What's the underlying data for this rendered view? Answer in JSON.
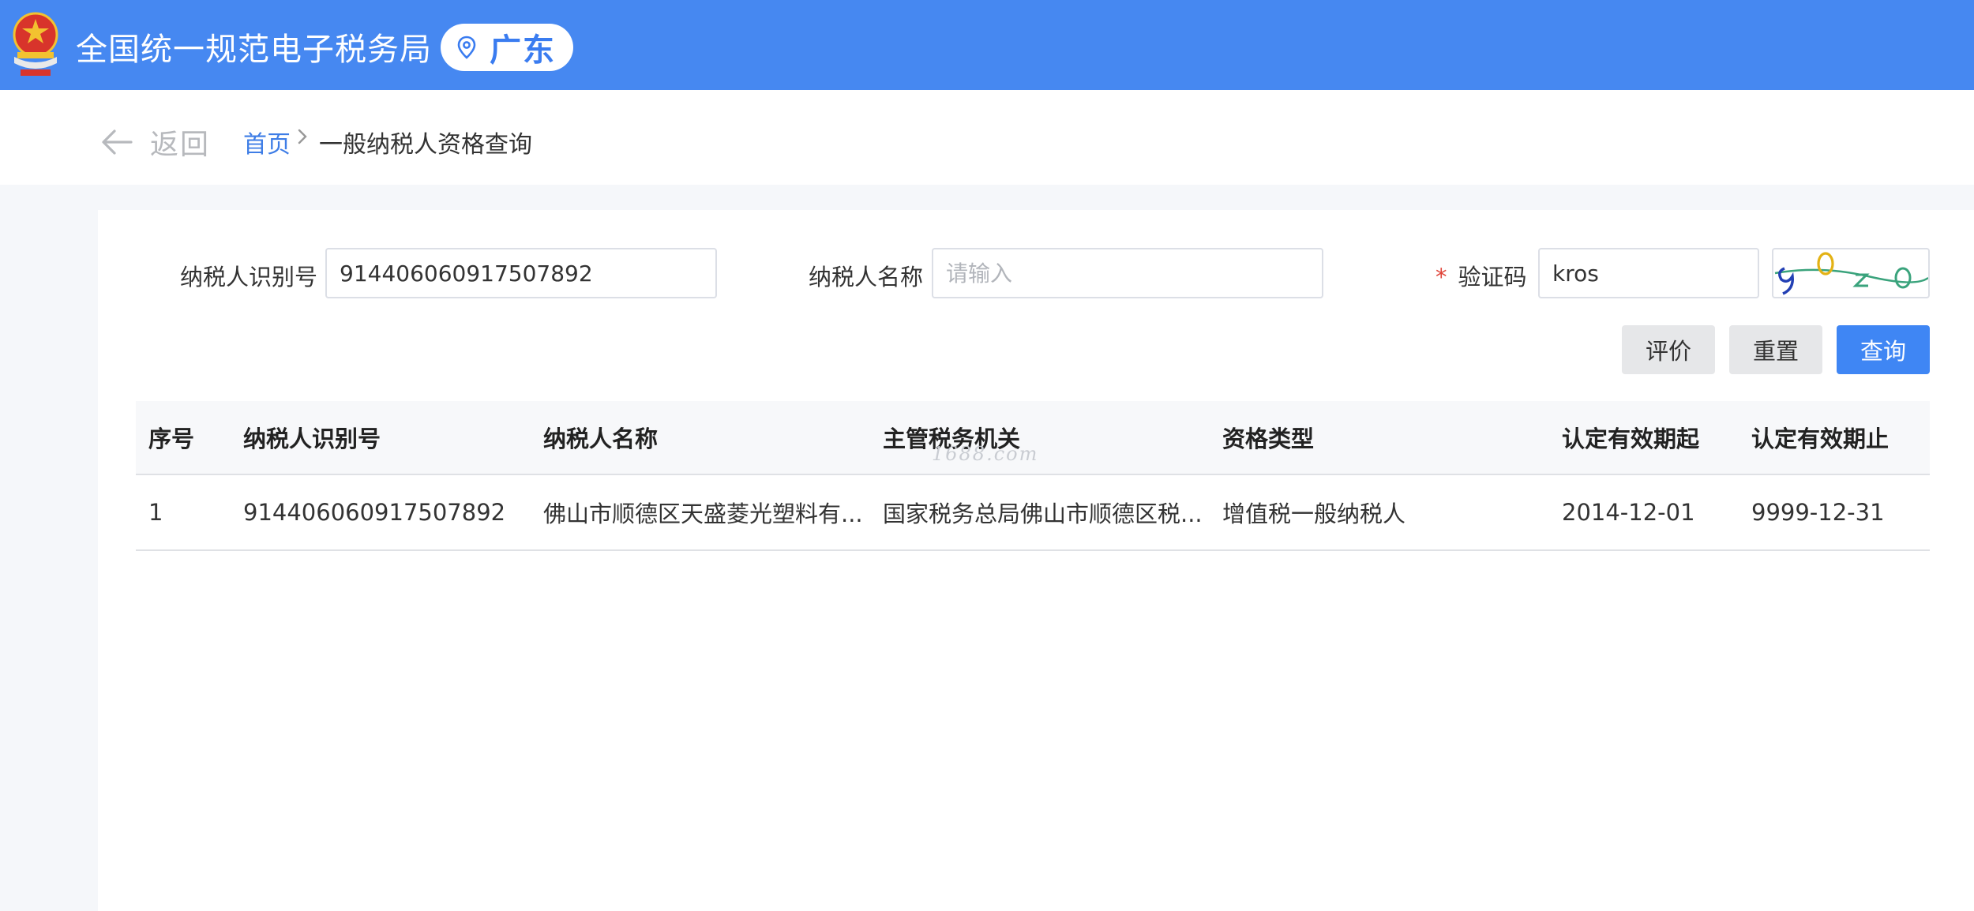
{
  "header": {
    "site_title": "全国统一规范电子税务局",
    "region": "广东",
    "colors": {
      "bar": "#4688f1",
      "accent": "#3a7cf0"
    }
  },
  "breadcrumb": {
    "back_label": "返回",
    "home": "首页",
    "current": "一般纳税人资格查询"
  },
  "form": {
    "taxpayer_id_label": "纳税人识别号",
    "taxpayer_id_value": "914406060917507892",
    "taxpayer_name_label": "纳税人名称",
    "taxpayer_name_placeholder": "请输入",
    "taxpayer_name_value": "",
    "captcha_required_mark": "*",
    "captcha_label": "验证码",
    "captcha_value": "kros"
  },
  "buttons": {
    "evaluate": "评价",
    "reset": "重置",
    "query": "查询"
  },
  "table": {
    "columns": [
      "序号",
      "纳税人识别号",
      "纳税人名称",
      "主管税务机关",
      "资格类型",
      "认定有效期起",
      "认定有效期止"
    ],
    "rows": [
      [
        "1",
        "914406060917507892",
        "佛山市顺德区天盛菱光塑料有...",
        "国家税务总局佛山市顺德区税...",
        "增值税一般纳税人",
        "2014-12-01",
        "9999-12-31"
      ]
    ]
  },
  "watermark": "1688.com"
}
